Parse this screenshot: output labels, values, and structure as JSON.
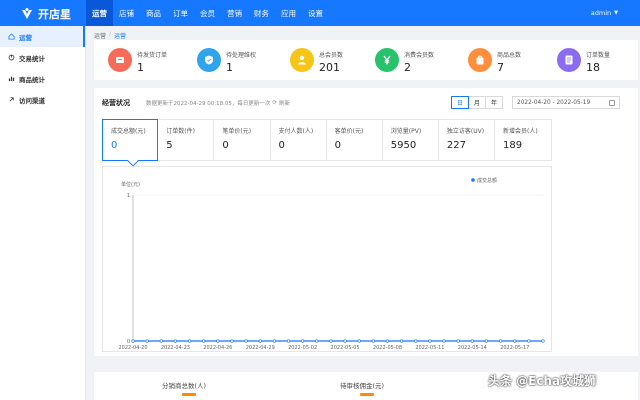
{
  "app": {
    "name": "开店星",
    "user": "admin"
  },
  "colors": {
    "primary": "#1677ff",
    "orange": "#ff8a00"
  },
  "nav": [
    {
      "label": "运营",
      "active": true
    },
    {
      "label": "店铺"
    },
    {
      "label": "商品"
    },
    {
      "label": "订单"
    },
    {
      "label": "会员"
    },
    {
      "label": "营销"
    },
    {
      "label": "财务"
    },
    {
      "label": "应用"
    },
    {
      "label": "设置"
    }
  ],
  "sidebar": [
    {
      "label": "运营",
      "icon": "home-icon",
      "active": true
    },
    {
      "label": "交易统计",
      "icon": "chart-icon"
    },
    {
      "label": "商品统计",
      "icon": "bar-icon"
    },
    {
      "label": "访问渠道",
      "icon": "link-icon"
    }
  ],
  "breadcrumb": [
    "运营",
    "运营"
  ],
  "stats": [
    {
      "label": "待发货订单",
      "value": "1",
      "color": "#f56c5a",
      "icon": "truck-icon"
    },
    {
      "label": "待处理维权",
      "value": "1",
      "color": "#2fa3ec",
      "icon": "shield-icon"
    },
    {
      "label": "总会员数",
      "value": "201",
      "color": "#f5c518",
      "icon": "user-icon"
    },
    {
      "label": "消费会员数",
      "value": "2",
      "color": "#27c26b",
      "icon": "yen-icon"
    },
    {
      "label": "商品总数",
      "value": "7",
      "color": "#ff8f3d",
      "icon": "bag-icon"
    },
    {
      "label": "订单数量",
      "value": "18",
      "color": "#8b6cf0",
      "icon": "doc-icon"
    }
  ],
  "panel": {
    "title": "经营状况",
    "note": "数据更新于2022-04-29 00:18:05，每日更新一次",
    "refresh": "刷新",
    "segments": [
      "日",
      "月",
      "年"
    ],
    "active_segment": 0,
    "date_range": "2022-04-20 - 2022-05-19"
  },
  "metrics": [
    {
      "label": "成交总额(元)",
      "value": "0",
      "active": true
    },
    {
      "label": "订单数(件)",
      "value": "5"
    },
    {
      "label": "笔单价(元)",
      "value": "0"
    },
    {
      "label": "支付人数(人)",
      "value": "0"
    },
    {
      "label": "客单价(元)",
      "value": "0"
    },
    {
      "label": "浏览量(PV)",
      "value": "5950"
    },
    {
      "label": "独立访客(UV)",
      "value": "227"
    },
    {
      "label": "新增会员(人)",
      "value": "189"
    }
  ],
  "chart_data": {
    "type": "line",
    "ylabel": "单位(元)",
    "ylim": [
      0,
      1
    ],
    "yticks": [
      "0",
      "1"
    ],
    "series": [
      {
        "name": "成交总额",
        "color": "#1677ff"
      }
    ],
    "x_tick_labels": [
      "2022-04-20",
      "2022-04-23",
      "2022-04-26",
      "2022-04-29",
      "2022-05-02",
      "2022-05-05",
      "2022-05-08",
      "2022-05-11",
      "2022-05-14",
      "2022-05-17"
    ],
    "x": [
      "2022-04-20",
      "2022-04-21",
      "2022-04-22",
      "2022-04-23",
      "2022-04-24",
      "2022-04-25",
      "2022-04-26",
      "2022-04-27",
      "2022-04-28",
      "2022-04-29",
      "2022-04-30",
      "2022-05-01",
      "2022-05-02",
      "2022-05-03",
      "2022-05-04",
      "2022-05-05",
      "2022-05-06",
      "2022-05-07",
      "2022-05-08",
      "2022-05-09",
      "2022-05-10",
      "2022-05-11",
      "2022-05-12",
      "2022-05-13",
      "2022-05-14",
      "2022-05-15",
      "2022-05-16",
      "2022-05-17",
      "2022-05-18",
      "2022-05-19"
    ],
    "values": [
      0,
      0,
      0,
      0,
      0,
      0,
      0,
      0,
      0,
      0,
      0,
      0,
      0,
      0,
      0,
      0,
      0,
      0,
      0,
      0,
      0,
      0,
      0,
      0,
      0,
      0,
      0,
      0,
      0,
      0
    ],
    "legend": "top-right"
  },
  "bottom": {
    "labels": [
      "分销商总数(人)",
      "待审核佣金(元)"
    ]
  },
  "watermark": "头条 @Echa攻城狮"
}
